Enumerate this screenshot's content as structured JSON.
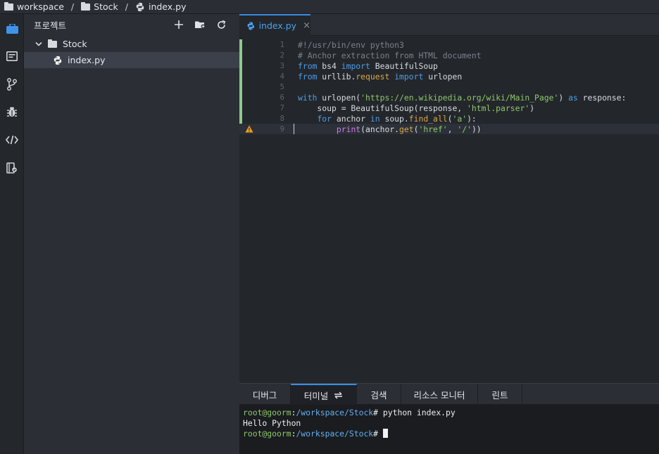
{
  "breadcrumb": {
    "items": [
      "workspace",
      "Stock",
      "index.py"
    ],
    "separator": "/"
  },
  "activity_bar": {
    "icons": [
      "project-icon",
      "document-icon",
      "git-branch-icon",
      "bug-icon",
      "code-icon",
      "package-icon"
    ]
  },
  "explorer": {
    "title": "프로젝트",
    "actions": [
      "add-icon",
      "new-folder-icon",
      "refresh-icon"
    ],
    "tree": {
      "folder": "Stock",
      "file": "index.py"
    }
  },
  "editor": {
    "tab_label": "index.py",
    "close_glyph": "×",
    "line_numbers": [
      "1",
      "2",
      "3",
      "4",
      "5",
      "6",
      "7",
      "8",
      "9"
    ],
    "active_line": 9,
    "warning_line": 9
  },
  "panel": {
    "tabs": [
      "디버그",
      "터미널",
      "검색",
      "리소스 모니터",
      "린트"
    ],
    "active_tab": "터미널",
    "terminal": {
      "prompt_user": "root@goorm",
      "prompt_sep": ":",
      "prompt_path": "/workspace/Stock",
      "prompt_end": "#",
      "command": " python index.py",
      "output": "Hello Python"
    }
  },
  "colors": {
    "accent": "#3a8ee6",
    "string": "#8cc96a",
    "keyword": "#4e9ee6",
    "warning": "#f0a020"
  }
}
